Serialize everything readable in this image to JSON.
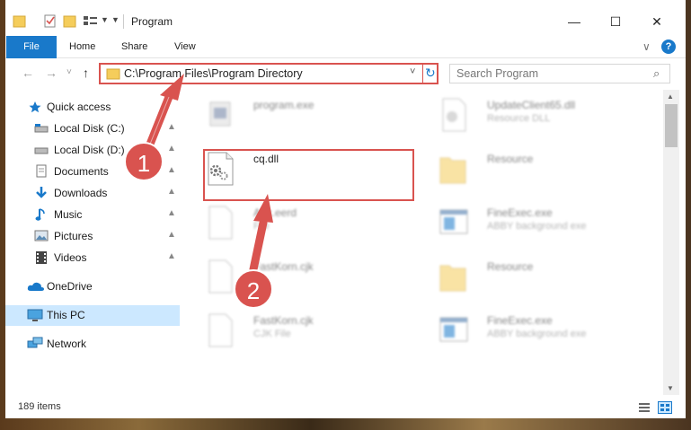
{
  "titlebar": {
    "title": "Program",
    "qa_icons": [
      "folder-icon",
      "properties-icon",
      "new-folder-icon",
      "view-options-icon",
      "dropdown-icon"
    ],
    "minimize": "—",
    "maximize": "☐",
    "close": "✕"
  },
  "ribbon": {
    "tabs": [
      "File",
      "Home",
      "Share",
      "View"
    ],
    "expand": "∨",
    "help": "?"
  },
  "address": {
    "back": "←",
    "forward": "→",
    "recent": "˅",
    "up": "↑",
    "path": "C:\\Program Files\\Program Directory",
    "dropdown": "˅",
    "refresh": "↻"
  },
  "search": {
    "placeholder": "Search Program",
    "icon": "⌕"
  },
  "nav": {
    "items": [
      {
        "label": "Quick access",
        "icon": "star-icon"
      },
      {
        "label": "Local Disk (C:)",
        "icon": "drive-icon",
        "pinned": true
      },
      {
        "label": "Local Disk (D:)",
        "icon": "drive-icon",
        "pinned": true
      },
      {
        "label": "Documents",
        "icon": "documents-icon",
        "pinned": true
      },
      {
        "label": "Downloads",
        "icon": "downloads-icon",
        "pinned": true
      },
      {
        "label": "Music",
        "icon": "music-icon",
        "pinned": true
      },
      {
        "label": "Pictures",
        "icon": "pictures-icon",
        "pinned": true
      },
      {
        "label": "Videos",
        "icon": "videos-icon",
        "pinned": true
      },
      {
        "label": "OneDrive",
        "icon": "onedrive-icon"
      },
      {
        "label": "This PC",
        "icon": "this-pc-icon",
        "selected": true
      },
      {
        "label": "Network",
        "icon": "network-icon"
      }
    ],
    "pin_glyph": "📌"
  },
  "files": [
    {
      "name": "program.exe",
      "type": "",
      "icon": "exe-icon",
      "blurred": true
    },
    {
      "name": "UpdateClient65.dll",
      "type": "Resource DLL",
      "icon": "dll-icon",
      "blurred": true
    },
    {
      "name": "cq.dll",
      "type": "",
      "icon": "dll-gear-icon",
      "blurred": false,
      "highlighted": true
    },
    {
      "name": "Resource",
      "type": "",
      "icon": "folder-icon",
      "blurred": true
    },
    {
      "name": "Abc.eerd",
      "type": "File",
      "icon": "file-icon",
      "blurred": true
    },
    {
      "name": "FineExec.exe",
      "type": "ABBY background exe",
      "icon": "app-window-icon",
      "blurred": true
    },
    {
      "name": "FastKorn.cjk",
      "type": "File",
      "icon": "file-icon",
      "blurred": true
    },
    {
      "name": "Resource",
      "type": "",
      "icon": "folder-icon",
      "blurred": true
    },
    {
      "name": "FastKorn.cjk",
      "type": "CJK File",
      "icon": "file-icon",
      "blurred": true
    },
    {
      "name": "FineExec.exe",
      "type": "ABBY background exe",
      "icon": "app-window-icon",
      "blurred": true
    }
  ],
  "status": {
    "items_count": "189 items"
  },
  "callouts": [
    "1",
    "2"
  ],
  "colors": {
    "accent": "#1979ca",
    "highlight": "#d9534f",
    "selected": "#cce8ff"
  }
}
